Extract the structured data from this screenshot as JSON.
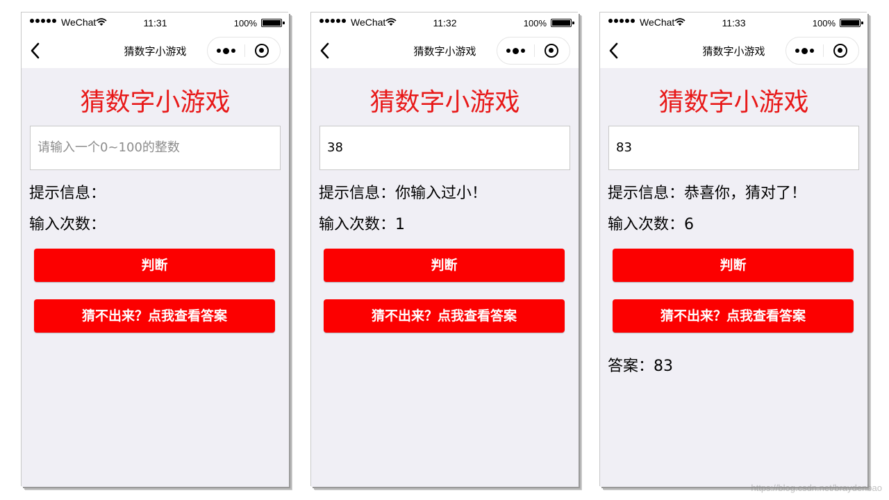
{
  "status_bar": {
    "carrier": "WeChat",
    "battery": "100%"
  },
  "nav": {
    "title": "猜数字小游戏"
  },
  "game_title": "猜数字小游戏",
  "colors": {
    "title_red": "#e81919",
    "button_red": "#fc0000",
    "background": "#f0eff5"
  },
  "icons": [
    "back-chevron-icon",
    "more-dots-icon",
    "close-target-icon",
    "wifi-icon",
    "battery-icon",
    "signal-dots-icon"
  ],
  "screens": [
    {
      "time": "11:31",
      "input_value": "",
      "input_placeholder": "请输入一个0~100的整数",
      "hint_line": "提示信息：",
      "count_line": "输入次数：",
      "judge_label": "判断",
      "answer_button_label": "猜不出来？点我查看答案",
      "answer_line": ""
    },
    {
      "time": "11:32",
      "input_value": "38",
      "input_placeholder": "",
      "hint_line": "提示信息：你输入过小！",
      "count_line": "输入次数：1",
      "judge_label": "判断",
      "answer_button_label": "猜不出来？点我查看答案",
      "answer_line": ""
    },
    {
      "time": "11:33",
      "input_value": "83",
      "input_placeholder": "",
      "hint_line": "提示信息：恭喜你，猜对了！",
      "count_line": "输入次数：6",
      "judge_label": "判断",
      "answer_button_label": "猜不出来？点我查看答案",
      "answer_line": "答案：83"
    }
  ],
  "watermark": "https://blog.csdn.net/braydenbao"
}
